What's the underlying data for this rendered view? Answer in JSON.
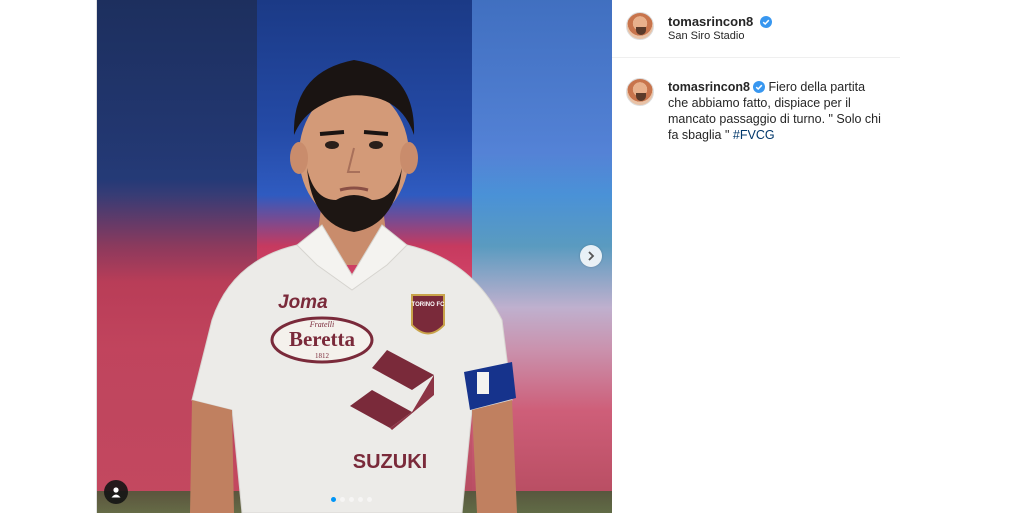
{
  "post": {
    "username": "tomasrincon8",
    "location": "San Siro Stadio",
    "caption": {
      "username": "tomasrincon8",
      "text": "Fiero della partita che abbiamo fatto, dispiace per il mancato passaggio di turno. \" Solo chi fa sbaglia \" ",
      "hashtag": "#FVCG"
    }
  },
  "media": {
    "jersey_sponsor_top": "Joma",
    "jersey_badge": "TORINO FC",
    "jersey_brand_small": "Fratelli",
    "jersey_brand": "Beretta",
    "jersey_brand_year": "1812",
    "jersey_sponsor_main": "SUZUKI",
    "carousel": {
      "count": 5,
      "active_index": 0
    }
  },
  "colors": {
    "verified": "#3897f0",
    "hashtag": "#00376b",
    "active_dot": "#0095f6",
    "jersey_maroon": "#7a2a3a"
  },
  "icons": {
    "verified": "verified-badge-icon",
    "next": "chevron-right-icon",
    "tag": "user-tag-icon"
  }
}
